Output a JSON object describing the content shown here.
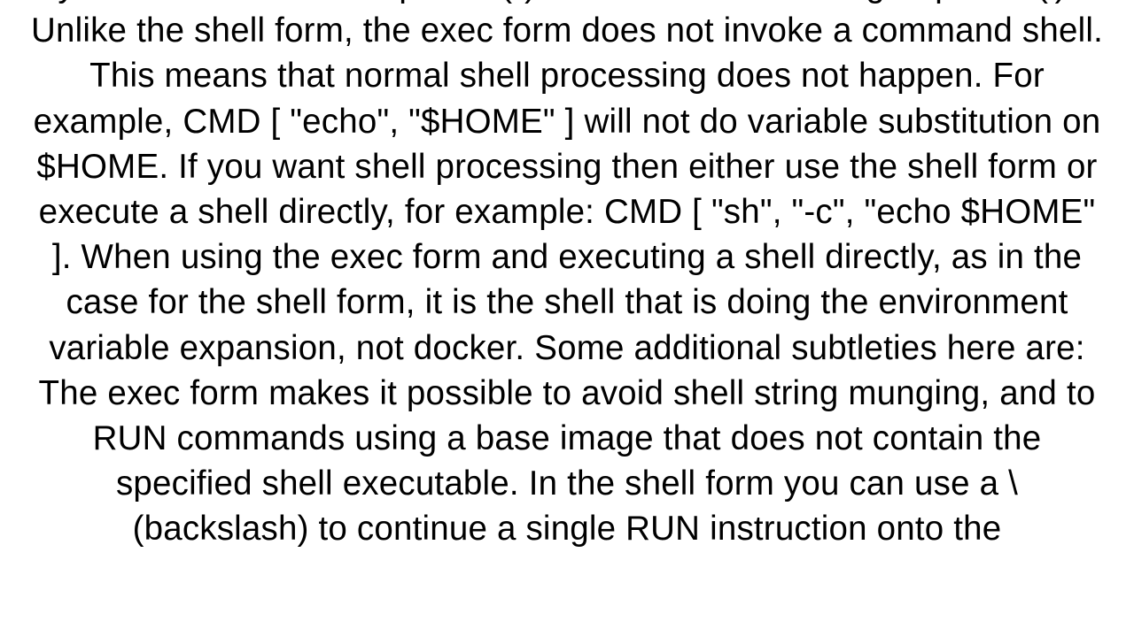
{
  "document": {
    "body_text": "you must use double-quotes (\") around words not single-quotes ('). Unlike the shell form, the exec form does not invoke a command shell. This means that normal shell processing does not happen. For example, CMD [ \"echo\", \"$HOME\" ] will not do variable substitution on $HOME. If you want shell processing then either use the shell form or execute a shell directly, for example: CMD [ \"sh\", \"-c\", \"echo $HOME\" ]. When using the exec form and executing a shell directly, as in the case for the shell form, it is the shell that is doing the environment variable expansion, not docker.  Some additional subtleties here are:  The exec form makes it possible to avoid shell string munging, and to RUN commands using a base image that does not contain the specified shell executable. In the shell form you can use a \\ (backslash) to continue a single RUN instruction onto the"
  }
}
